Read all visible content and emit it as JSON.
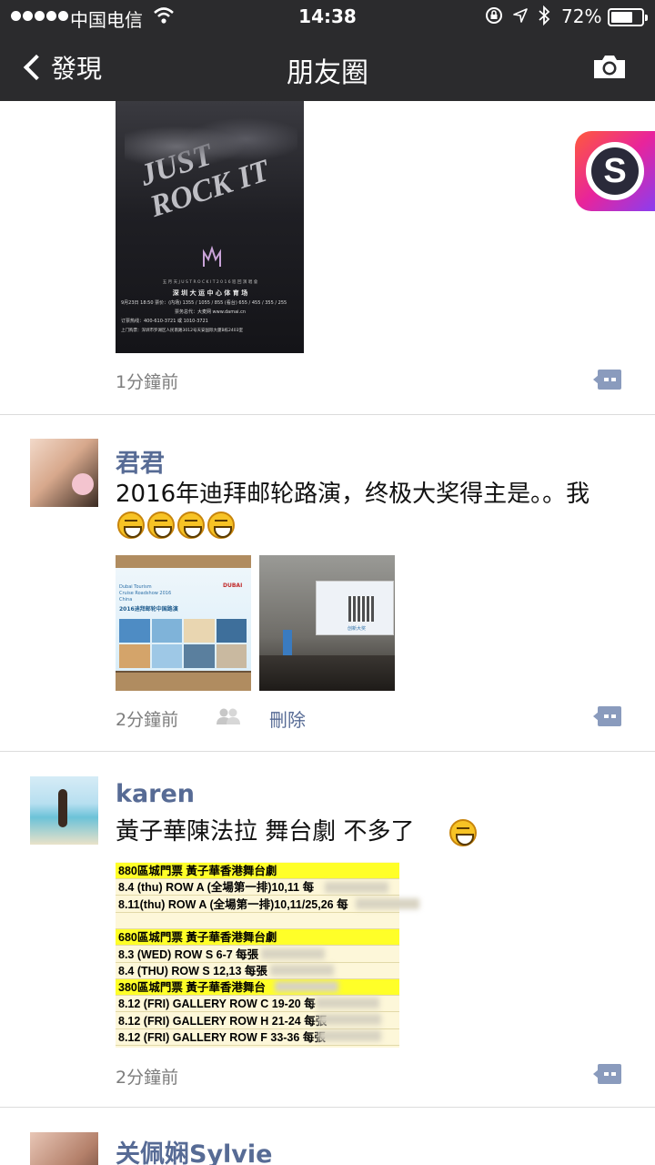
{
  "status_bar": {
    "carrier": "中国电信",
    "time": "14:38",
    "battery": "72%",
    "battery_level": 0.72
  },
  "nav": {
    "back_label": "發現",
    "title": "朋友圈"
  },
  "icons": {
    "back": "chevron-left-icon",
    "camera": "camera-icon",
    "comment": "comment-bubble-icon",
    "group": "people-icon",
    "app": "sketch-app-icon"
  },
  "app_icon_letter": "S",
  "colors": {
    "nav_background": "#2b2b2d",
    "username": "#576b95",
    "timestamp": "#7d7d7d"
  },
  "posts": [
    {
      "poster": {
        "band_text": "JUST ROCK IT",
        "line1": "五 月 天  J U S T  R O C K  I T  2 0 1 6  巡 回 演 唱 會",
        "venue": "深  圳  大  运  中  心  体  育  场",
        "date_line": "9月23日 18:50 票价：(内场) 1355 / 1055 / 855 (看台) 655 / 455 / 355 / 255",
        "agent_line": "票务总代：大麦网  www.damai.cn",
        "phone_line": "订票热线：400-610-3721 或 1010-3721",
        "address_line": "上门购票：深圳市罗湖区人民南路3012号天安国际大厦B栋2403室"
      },
      "time_ago": "1分鐘前"
    },
    {
      "username": "君君",
      "text": "2016年迪拜邮轮路演，终极大奖得主是。。我",
      "emoji_count": 4,
      "photo1": {
        "board_line1": "Dubai Tourism",
        "board_line2": "Cruise Roadshow 2016",
        "board_line3": "China",
        "board_line4": "2016迪拜邮轮中国路演",
        "logo": "DUBAI"
      },
      "photo2": {
        "screen_caption": "创新大奖"
      },
      "time_ago": "2分鐘前",
      "delete_label": "刪除"
    },
    {
      "username": "karen",
      "text": "黃子華陳法拉 舞台劇 不多了",
      "ticket_rows": [
        {
          "text": "880區城門票 黃子華香港舞台劇",
          "header": true
        },
        {
          "text": "8.4 (thu) ROW A    (全場第一排)10,11 每",
          "header": false
        },
        {
          "text": "8.11(thu) ROW A    (全場第一排)10,11/25,26 每",
          "header": false
        },
        {
          "text": "",
          "header": false
        },
        {
          "text": "680區城門票 黃子華香港舞台劇",
          "header": true
        },
        {
          "text": "8.3 (WED) ROW S 6-7 每張",
          "header": false
        },
        {
          "text": "8.4 (THU) ROW S 12,13 每張",
          "header": false
        },
        {
          "text": "380區城門票 黃子華香港舞台",
          "header": true
        },
        {
          "text": "8.12 (FRI) GALLERY ROW C 19-20 每",
          "header": false
        },
        {
          "text": "8.12 (FRI) GALLERY ROW H 21-24 每張",
          "header": false
        },
        {
          "text": "8.12 (FRI) GALLERY ROW F 33-36 每張",
          "header": false
        }
      ],
      "time_ago": "2分鐘前"
    },
    {
      "username": "关佩娴Sylvie"
    }
  ]
}
